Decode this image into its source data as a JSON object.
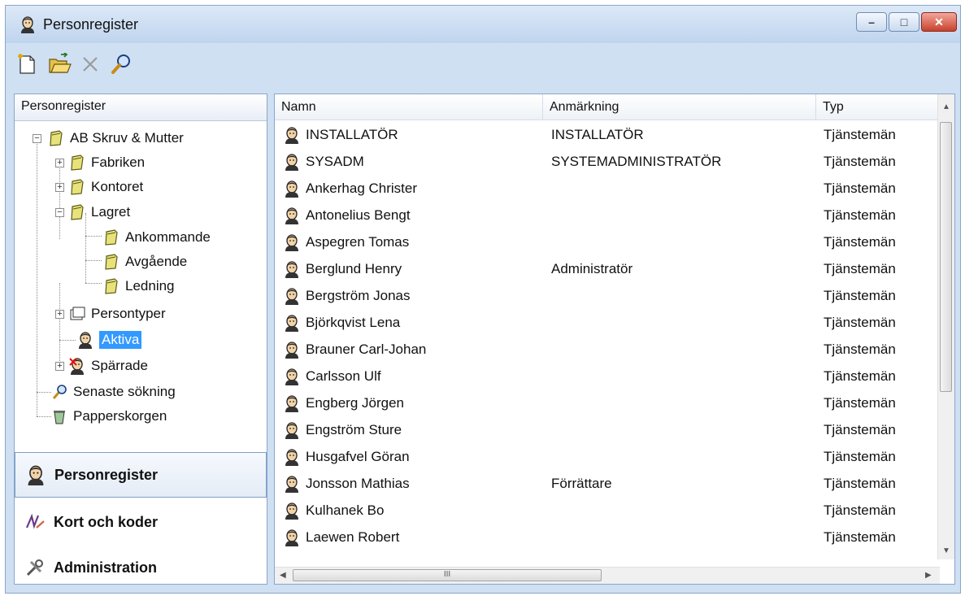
{
  "window": {
    "title": "Personregister",
    "controls": {
      "minimize": "–",
      "maximize": "□",
      "close": "✕"
    }
  },
  "toolbar": {
    "buttons": [
      {
        "name": "new",
        "icon": "new-document-icon"
      },
      {
        "name": "open",
        "icon": "open-folder-icon"
      },
      {
        "name": "delete",
        "icon": "delete-x-icon"
      },
      {
        "name": "search",
        "icon": "magnifier-icon"
      }
    ]
  },
  "left": {
    "header": "Personregister",
    "tree": {
      "root": "AB Skruv & Mutter",
      "fabriken": "Fabriken",
      "kontoret": "Kontoret",
      "lagret": "Lagret",
      "ankommande": "Ankommande",
      "avgaende": "Avgående",
      "ledning": "Ledning",
      "persontyper": "Persontyper",
      "aktiva": "Aktiva",
      "sparrade": "Spärrade",
      "senaste": "Senaste sökning",
      "papperskorgen": "Papperskorgen"
    },
    "nav": {
      "personregister": "Personregister",
      "kort": "Kort och koder",
      "admin": "Administration"
    }
  },
  "table": {
    "columns": [
      "Namn",
      "Anmärkning",
      "Typ"
    ],
    "rows": [
      {
        "namn": "INSTALLATÖR",
        "anm": "INSTALLATÖR",
        "typ": "Tjänstemän"
      },
      {
        "namn": "SYSADM",
        "anm": "SYSTEMADMINISTRATÖR",
        "typ": "Tjänstemän"
      },
      {
        "namn": "Ankerhag Christer",
        "anm": "",
        "typ": "Tjänstemän"
      },
      {
        "namn": "Antonelius Bengt",
        "anm": "",
        "typ": "Tjänstemän"
      },
      {
        "namn": "Aspegren Tomas",
        "anm": "",
        "typ": "Tjänstemän"
      },
      {
        "namn": "Berglund Henry",
        "anm": "Administratör",
        "typ": "Tjänstemän"
      },
      {
        "namn": "Bergström Jonas",
        "anm": "",
        "typ": "Tjänstemän"
      },
      {
        "namn": "Björkqvist Lena",
        "anm": "",
        "typ": "Tjänstemän"
      },
      {
        "namn": "Brauner Carl-Johan",
        "anm": "",
        "typ": "Tjänstemän"
      },
      {
        "namn": "Carlsson Ulf",
        "anm": "",
        "typ": "Tjänstemän"
      },
      {
        "namn": "Engberg Jörgen",
        "anm": "",
        "typ": "Tjänstemän"
      },
      {
        "namn": "Engström Sture",
        "anm": "",
        "typ": "Tjänstemän"
      },
      {
        "namn": "Husgafvel Göran",
        "anm": "",
        "typ": "Tjänstemän"
      },
      {
        "namn": "Jonsson Mathias",
        "anm": "Förrättare",
        "typ": "Tjänstemän"
      },
      {
        "namn": "Kulhanek Bo",
        "anm": "",
        "typ": "Tjänstemän"
      },
      {
        "namn": "Laewen Robert",
        "anm": "",
        "typ": "Tjänstemän"
      }
    ],
    "hscroll_grip": "III"
  }
}
